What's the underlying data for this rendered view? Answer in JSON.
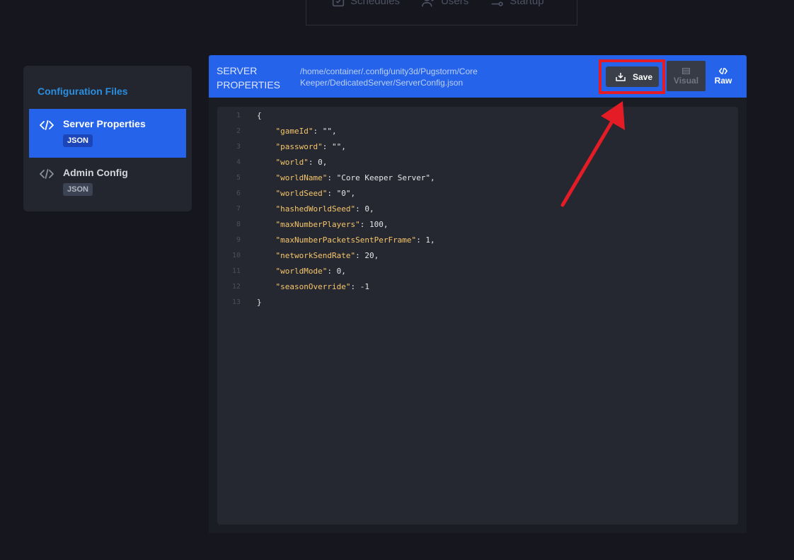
{
  "topnav": {
    "items": [
      {
        "label": "Schedules",
        "icon": "calendar-check-icon"
      },
      {
        "label": "Users",
        "icon": "users-icon"
      },
      {
        "label": "Startup",
        "icon": "sliders-icon"
      }
    ]
  },
  "sidebar": {
    "title": "Configuration Files",
    "items": [
      {
        "label": "Server Properties",
        "badge": "JSON",
        "icon": "code-icon",
        "active": true
      },
      {
        "label": "Admin Config",
        "badge": "JSON",
        "icon": "code-icon",
        "active": false
      }
    ]
  },
  "panel": {
    "title": "SERVER PROPERTIES",
    "path": "/home/container/.config/unity3d/Pugstorm/Core Keeper/DedicatedServer/ServerConfig.json",
    "save_label": "Save",
    "view_visual_label": "Visual",
    "view_raw_label": "Raw"
  },
  "editor": {
    "lines": [
      {
        "num": "1",
        "key": "",
        "text": "{"
      },
      {
        "num": "2",
        "key": "\"gameId\"",
        "text": ": \"\","
      },
      {
        "num": "3",
        "key": "\"password\"",
        "text": ": \"\","
      },
      {
        "num": "4",
        "key": "\"world\"",
        "text": ": 0,"
      },
      {
        "num": "5",
        "key": "\"worldName\"",
        "text": ": \"Core Keeper Server\","
      },
      {
        "num": "6",
        "key": "\"worldSeed\"",
        "text": ": \"0\","
      },
      {
        "num": "7",
        "key": "\"hashedWorldSeed\"",
        "text": ": 0,"
      },
      {
        "num": "8",
        "key": "\"maxNumberPlayers\"",
        "text": ": 100,"
      },
      {
        "num": "9",
        "key": "\"maxNumberPacketsSentPerFrame\"",
        "text": ": 1,"
      },
      {
        "num": "10",
        "key": "\"networkSendRate\"",
        "text": ": 20,"
      },
      {
        "num": "11",
        "key": "\"worldMode\"",
        "text": ": 0,"
      },
      {
        "num": "12",
        "key": "\"seasonOverride\"",
        "text": ": -1"
      },
      {
        "num": "13",
        "key": "",
        "text": "}"
      }
    ]
  },
  "colors": {
    "accent": "#2563eb",
    "annotation": "#e31c25",
    "json_key": "#f6c66b"
  }
}
